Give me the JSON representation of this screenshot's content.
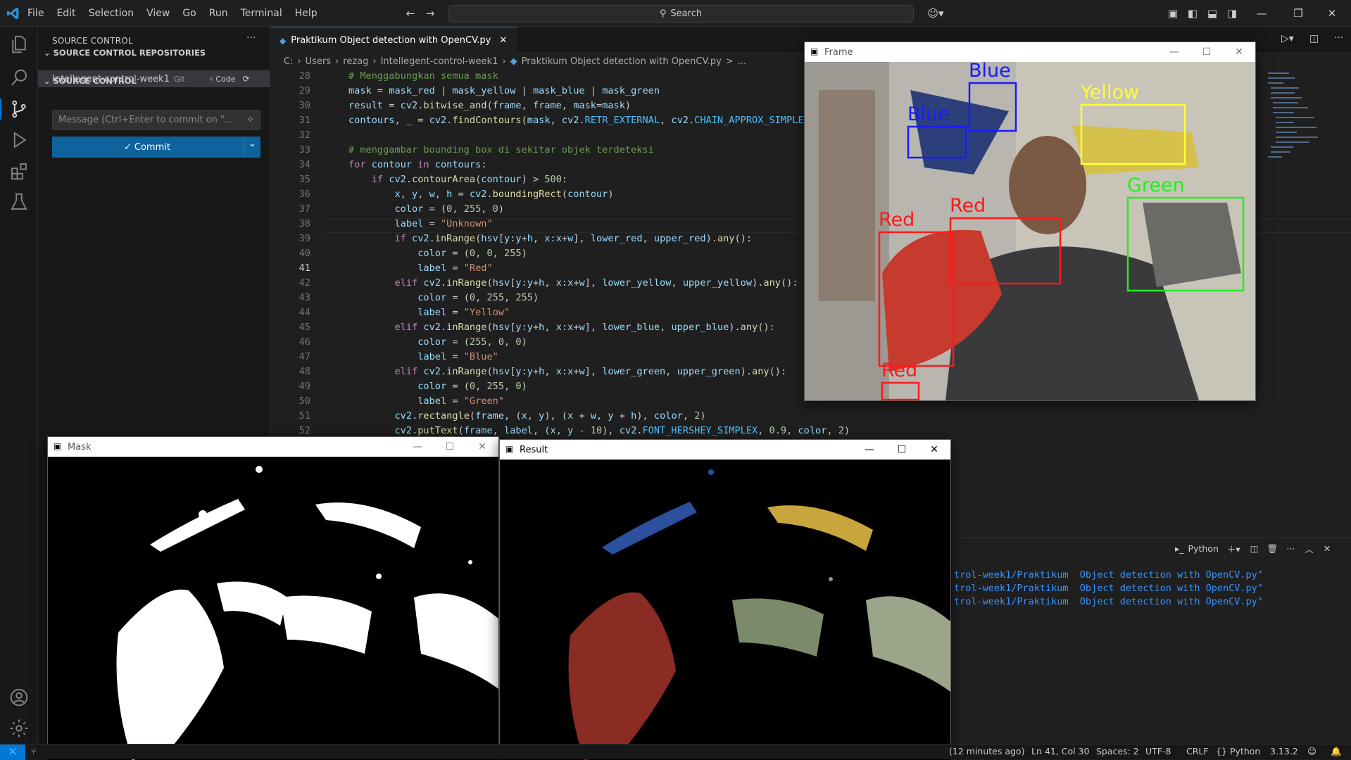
{
  "menu": [
    "File",
    "Edit",
    "Selection",
    "View",
    "Go",
    "Run",
    "Terminal",
    "Help"
  ],
  "search": {
    "label": "Search"
  },
  "sidebar": {
    "title": "SOURCE CONTROL",
    "repos_header": "SOURCE CONTROL REPOSITORIES",
    "repo_name": "Intellegent-control-week1",
    "repo_provider": "Git",
    "repo_branch": "Code",
    "sc_header": "SOURCE CONTROL",
    "message_placeholder": "Message (Ctrl+Enter to commit on \"...",
    "commit_label": "Commit"
  },
  "editor": {
    "tab_label": "Praktikum Object detection with OpenCV.py",
    "breadcrumb": [
      "C:",
      "Users",
      "rezag",
      "Intellegent-control-week1",
      "Praktikum  Object detection with OpenCV.py",
      ">",
      "..."
    ],
    "line_numbers": [
      "28",
      "29",
      "30",
      "31",
      "32",
      "33",
      "34",
      "35",
      "36",
      "37",
      "38",
      "39",
      "40",
      "41",
      "42",
      "43",
      "44",
      "45",
      "46",
      "47",
      "48",
      "49",
      "50",
      "51",
      "52"
    ],
    "current_line": "41"
  },
  "windows": {
    "frame": {
      "title": "Frame",
      "labels": [
        "Blue",
        "Blue",
        "Yellow",
        "Green",
        "Red",
        "Red",
        "Red"
      ]
    },
    "mask": {
      "title": "Mask"
    },
    "result": {
      "title": "Result"
    }
  },
  "terminal": {
    "lines": [
      "trol-week1/Praktikum  Object detection with OpenCV.py\"",
      "trol-week1/Praktikum  Object detection with OpenCV.py\"",
      "trol-week1/Praktikum  Object detection with OpenCV.py\""
    ],
    "shell_label": "Python"
  },
  "status": {
    "time": "(12 minutes ago)",
    "position": "Ln 41, Col 30",
    "spaces": "Spaces: 2",
    "encoding": "UTF-8",
    "eol": "CRLF",
    "language": "Python",
    "version": "3.13.2"
  },
  "colors": {
    "accent": "#0078d4",
    "commit_button": "#0e639c",
    "box_red": "#ff1a1a",
    "box_blue": "#1a1aff",
    "box_yellow": "#ffff33",
    "box_green": "#22ee22"
  }
}
